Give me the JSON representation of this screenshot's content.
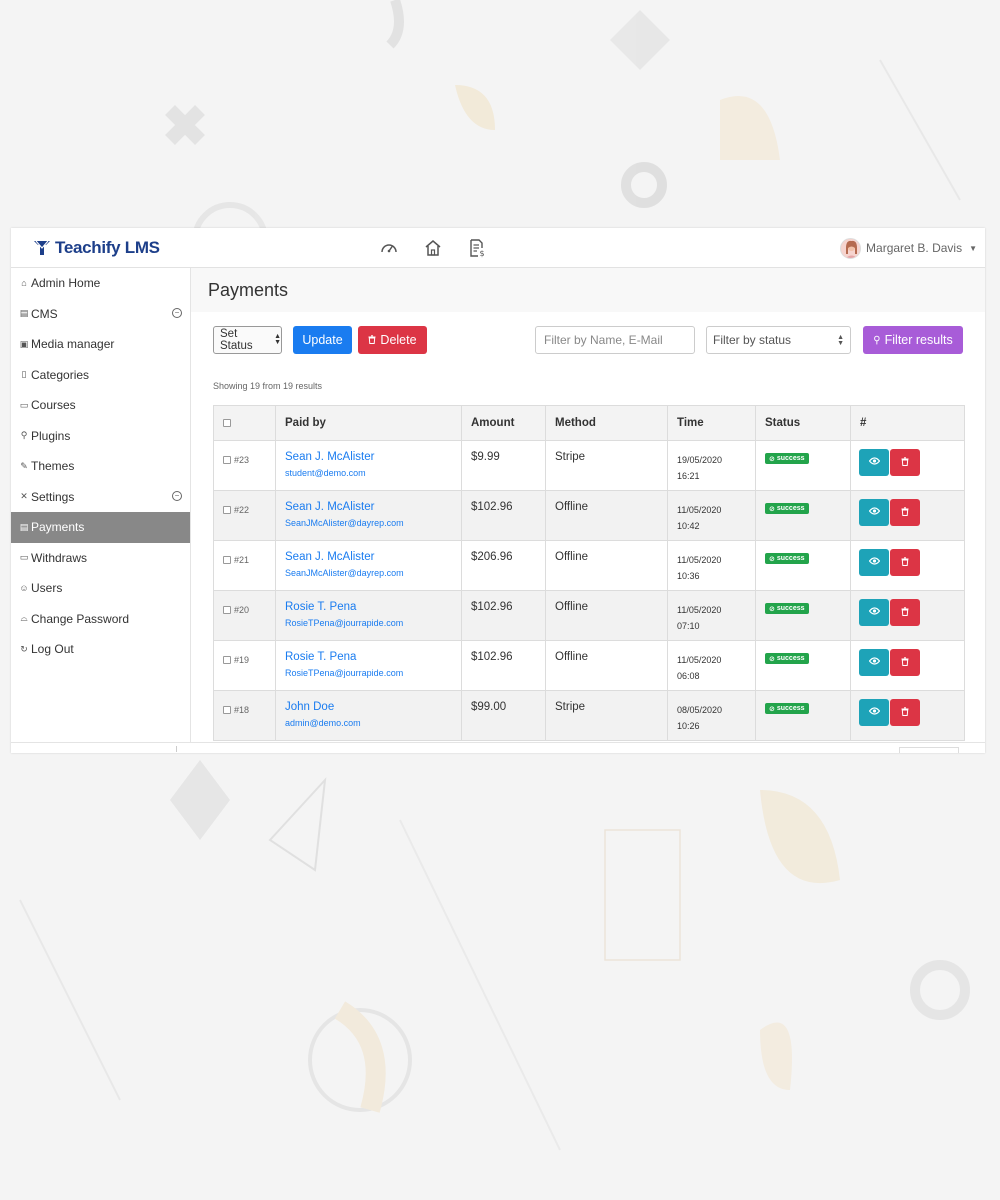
{
  "app": {
    "brand": "Teachify LMS",
    "user_name": "Margaret B. Davis",
    "top_icons": [
      "dashboard-icon",
      "home-icon",
      "invoice-icon"
    ]
  },
  "sidebar": {
    "items": [
      {
        "label": "Admin Home",
        "icon": "home-icon",
        "glyph": "⌂"
      },
      {
        "label": "CMS",
        "icon": "cms-icon",
        "glyph": "▤",
        "expandable": true
      },
      {
        "label": "Media manager",
        "icon": "media-icon",
        "glyph": "▣"
      },
      {
        "label": "Categories",
        "icon": "categories-icon",
        "glyph": "▯"
      },
      {
        "label": "Courses",
        "icon": "courses-icon",
        "glyph": "▭"
      },
      {
        "label": "Plugins",
        "icon": "plugins-icon",
        "glyph": "⚲"
      },
      {
        "label": "Themes",
        "icon": "themes-icon",
        "glyph": "✎"
      },
      {
        "label": "Settings",
        "icon": "settings-icon",
        "glyph": "✕",
        "expandable": true
      },
      {
        "label": "Payments",
        "icon": "payments-icon",
        "glyph": "▤",
        "active": true
      },
      {
        "label": "Withdraws",
        "icon": "withdraws-icon",
        "glyph": "▭"
      },
      {
        "label": "Users",
        "icon": "users-icon",
        "glyph": "☺"
      },
      {
        "label": "Change Password",
        "icon": "lock-icon",
        "glyph": "⌓"
      },
      {
        "label": "Log Out",
        "icon": "logout-icon",
        "glyph": "↻"
      }
    ]
  },
  "page": {
    "title": "Payments"
  },
  "toolbar": {
    "set_status": "Set Status",
    "update_label": "Update",
    "delete_label": "Delete",
    "filter_placeholder": "Filter by Name, E-Mail",
    "status_filter": "Filter by status",
    "filter_button": "Filter results"
  },
  "results": {
    "showing_text": "Showing 19 from 19 results"
  },
  "table": {
    "headers": [
      "Paid by",
      "Amount",
      "Method",
      "Time",
      "Status",
      "#"
    ],
    "rows": [
      {
        "id": "#23",
        "name": "Sean J. McAlister",
        "email": "student@demo.com",
        "amount": "$9.99",
        "method": "Stripe",
        "date": "19/05/2020",
        "time": "16:21",
        "status": "success"
      },
      {
        "id": "#22",
        "name": "Sean J. McAlister",
        "email": "SeanJMcAlister@dayrep.com",
        "amount": "$102.96",
        "method": "Offline",
        "date": "11/05/2020",
        "time": "10:42",
        "status": "success"
      },
      {
        "id": "#21",
        "name": "Sean J. McAlister",
        "email": "SeanJMcAlister@dayrep.com",
        "amount": "$206.96",
        "method": "Offline",
        "date": "11/05/2020",
        "time": "10:36",
        "status": "success"
      },
      {
        "id": "#20",
        "name": "Rosie T. Pena",
        "email": "RosieTPena@jourrapide.com",
        "amount": "$102.96",
        "method": "Offline",
        "date": "11/05/2020",
        "time": "07:10",
        "status": "success"
      },
      {
        "id": "#19",
        "name": "Rosie T. Pena",
        "email": "RosieTPena@jourrapide.com",
        "amount": "$102.96",
        "method": "Offline",
        "date": "11/05/2020",
        "time": "06:08",
        "status": "success"
      },
      {
        "id": "#18",
        "name": "John Doe",
        "email": "admin@demo.com",
        "amount": "$99.00",
        "method": "Stripe",
        "date": "08/05/2020",
        "time": "10:26",
        "status": "success"
      }
    ]
  },
  "colors": {
    "brand": "#1d3f8a",
    "primary": "#1a7cf0",
    "danger": "#dc3545",
    "info": "#1ea3b8",
    "purple": "#a85cd8",
    "success": "#23a44b",
    "sidebar_active": "#888888"
  }
}
